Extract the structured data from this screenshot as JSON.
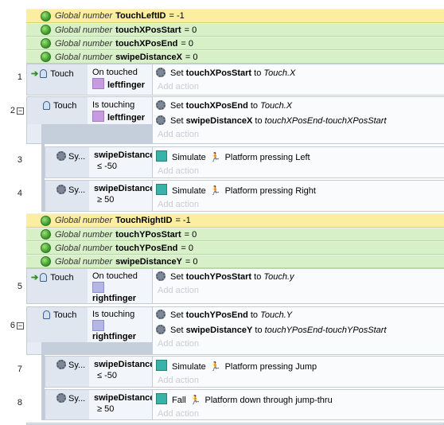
{
  "globals_top": [
    {
      "kind": "Global number",
      "name": "TouchLeftID",
      "value": "= -1"
    },
    {
      "kind": "Global number",
      "name": "touchXPosStart",
      "value": "= 0"
    },
    {
      "kind": "Global number",
      "name": "touchXPosEnd",
      "value": "= 0"
    },
    {
      "kind": "Global number",
      "name": "swipeDistanceX",
      "value": "= 0"
    }
  ],
  "globals_bottom": [
    {
      "kind": "Global number",
      "name": "TouchRightID",
      "value": "= -1"
    },
    {
      "kind": "Global number",
      "name": "touchYPosStart",
      "value": "= 0"
    },
    {
      "kind": "Global number",
      "name": "touchYPosEnd",
      "value": "= 0"
    },
    {
      "kind": "Global number",
      "name": "swipeDistanceY",
      "value": "= 0"
    }
  ],
  "add_action": "Add action",
  "events": {
    "e1": {
      "num": "1",
      "obj": "Touch",
      "cond": "On touched",
      "param": "leftfinger",
      "act": {
        "pre": "Set",
        "var": "touchXPosStart",
        "mid": "to",
        "expr": "Touch.X"
      }
    },
    "e2": {
      "num": "2",
      "obj": "Touch",
      "cond": "Is touching",
      "param": "leftfinger",
      "acts": [
        {
          "pre": "Set",
          "var": "touchXPosEnd",
          "mid": "to",
          "expr": "Touch.X"
        },
        {
          "pre": "Set",
          "var": "swipeDistanceX",
          "mid": "to",
          "expr": "touchXPosEnd-touchXPosStart"
        }
      ]
    },
    "e3": {
      "num": "3",
      "obj": "Sy...",
      "cond": "swipeDistance",
      "cmp": "≤ -50",
      "act_obj": "Simulate",
      "act_target": "Platform pressing Left"
    },
    "e4": {
      "num": "4",
      "obj": "Sy...",
      "cond": "swipeDistance",
      "cmp": "≥ 50",
      "act_obj": "Simulate",
      "act_target": "Platform pressing Right"
    },
    "e5": {
      "num": "5",
      "obj": "Touch",
      "cond": "On touched",
      "param": "rightfinger",
      "act": {
        "pre": "Set",
        "var": "touchYPosStart",
        "mid": "to",
        "expr": "Touch.y"
      }
    },
    "e6": {
      "num": "6",
      "obj": "Touch",
      "cond": "Is touching",
      "param": "rightfinger",
      "acts": [
        {
          "pre": "Set",
          "var": "touchYPosEnd",
          "mid": "to",
          "expr": "Touch.Y"
        },
        {
          "pre": "Set",
          "var": "swipeDistanceY",
          "mid": "to",
          "expr": "touchYPosEnd-touchYPosStart"
        }
      ]
    },
    "e7": {
      "num": "7",
      "obj": "Sy...",
      "cond": "swipeDistance",
      "cmp": "≤ -50",
      "act_obj": "Simulate",
      "act_target": "Platform pressing Jump"
    },
    "e8": {
      "num": "8",
      "obj": "Sy...",
      "cond": "swipeDistance",
      "cmp": "≥ 50",
      "act_obj": "Fall",
      "act_target": "Platform down through jump-thru"
    }
  }
}
